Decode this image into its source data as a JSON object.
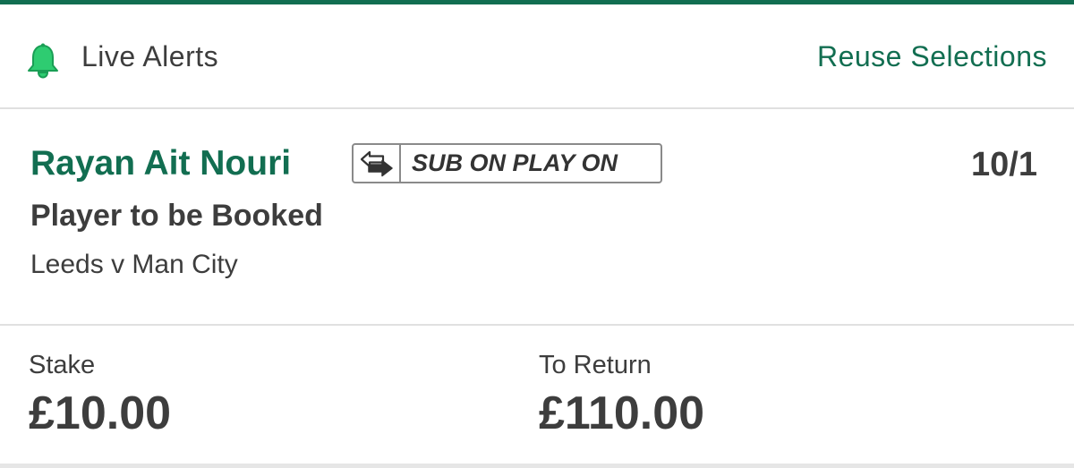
{
  "colors": {
    "accent": "#126e51",
    "text": "#3d3d3d",
    "divider": "#e0e0e0",
    "bell": "#2ecc71"
  },
  "header": {
    "bell_icon": "bell-icon",
    "alerts_label": "Live Alerts",
    "reuse_label": "Reuse Selections"
  },
  "selection": {
    "player_name": "Rayan Ait Nouri",
    "badge_icon": "swap-arrows-icon",
    "badge_label": "SUB ON PLAY ON",
    "odds": "10/1",
    "market": "Player to be Booked",
    "event": "Leeds v Man City"
  },
  "footer": {
    "stake_label": "Stake",
    "stake_value": "£10.00",
    "return_label": "To Return",
    "return_value": "£110.00"
  }
}
